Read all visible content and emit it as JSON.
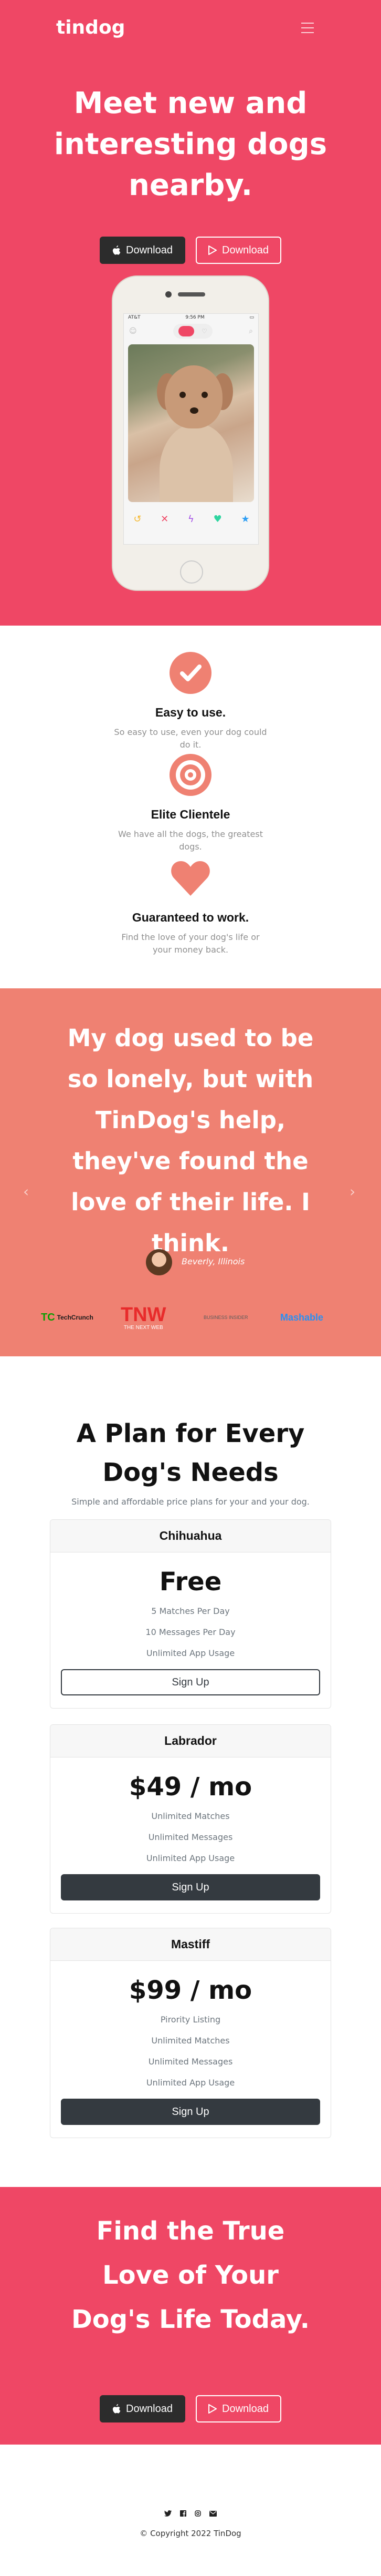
{
  "nav": {
    "brand": "tindog"
  },
  "hero": {
    "heading": "Meet new and interesting dogs nearby.",
    "btn_primary": "Download",
    "btn_secondary": "Download",
    "phone_time": "9:56 PM",
    "phone_carrier": "AT&T"
  },
  "features": [
    {
      "title": "Easy to use.",
      "text": "So easy to use, even your dog could do it."
    },
    {
      "title": "Elite Clientele",
      "text": "We have all the dogs, the greatest dogs."
    },
    {
      "title": "Guaranteed to work.",
      "text": "Find the love of your dog's life or your money back."
    }
  ],
  "testimonial": {
    "quote": "My dog used to be so lonely, but with TinDog's help, they've found the love of their life. I think.",
    "cite": "Beverly, Illinois",
    "logos": [
      "TechCrunch",
      "TNW",
      "BUSINESS INSIDER",
      "Mashable"
    ],
    "tnw_sub": "THE NEXT WEB"
  },
  "pricing": {
    "heading": "A Plan for Every Dog's Needs",
    "subheading": "Simple and affordable price plans for your and your dog.",
    "plans": [
      {
        "name": "Chihuahua",
        "price": "Free",
        "features": [
          "5 Matches Per Day",
          "10 Messages Per Day",
          "Unlimited App Usage"
        ],
        "cta": "Sign Up"
      },
      {
        "name": "Labrador",
        "price": "$49 / mo",
        "features": [
          "Unlimited Matches",
          "Unlimited Messages",
          "Unlimited App Usage"
        ],
        "cta": "Sign Up"
      },
      {
        "name": "Mastiff",
        "price": "$99 / mo",
        "features": [
          "Pirority Listing",
          "Unlimited Matches",
          "Unlimited Messages",
          "Unlimited App Usage"
        ],
        "cta": "Sign Up"
      }
    ]
  },
  "cta": {
    "heading": "Find the True Love of Your Dog's Life Today.",
    "btn_primary": "Download",
    "btn_secondary": "Download"
  },
  "footer": {
    "social_icons": [
      "twitter-icon",
      "facebook-icon",
      "instagram-icon",
      "envelope-icon"
    ],
    "copyright": "© Copyright 2022 TinDog"
  },
  "colors": {
    "primary": "#ef4765",
    "testimonial_bg": "#ef8172",
    "dark": "#343a40"
  }
}
